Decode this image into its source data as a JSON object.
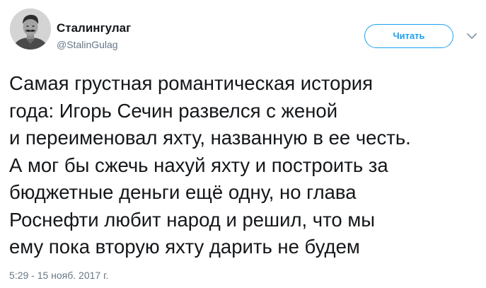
{
  "author": {
    "display_name": "Сталингулаг",
    "handle": "@StalinGulag"
  },
  "follow_button": {
    "label": "Читать"
  },
  "tweet": {
    "lines": [
      "Самая грустная романтическая история",
      "года: Игорь Сечин развелся с женой",
      "и переименовал яхту, названную в ее честь.",
      "А мог бы сжечь нахуй яхту и построить за",
      "бюджетные деньги ещё одну, но глава",
      "Роснефти любит народ и решил, что мы",
      "ему пока вторую яхту дарить не будем"
    ],
    "timestamp": "5:29 - 15 нояб. 2017 г."
  },
  "icons": {
    "avatar": "portrait-avatar",
    "more": "chevron-down-icon"
  },
  "colors": {
    "accent": "#1da1f2",
    "text": "#14171a",
    "muted": "#657786"
  }
}
